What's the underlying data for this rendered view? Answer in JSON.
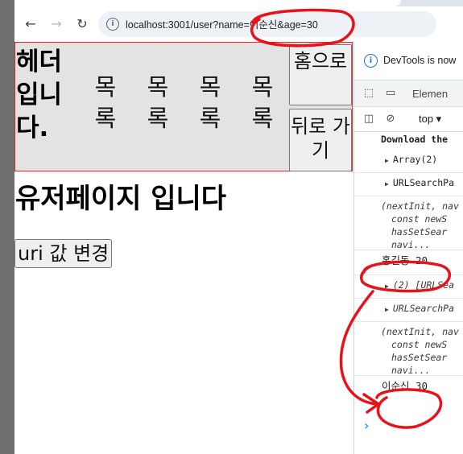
{
  "browser": {
    "back_icon": "back-arrow-icon",
    "forward_icon": "forward-arrow-icon",
    "reload_icon": "reload-icon",
    "url": "localhost:3001/user?name=이순신&age=30"
  },
  "page": {
    "header": {
      "title": "헤더 입니다.",
      "menu": [
        "목록",
        "목록",
        "목록",
        "목록"
      ],
      "home_button": "홈으로",
      "back_button": "뒤로 가기"
    },
    "title": "유저페이지 입니다",
    "change_button": "uri 값 변경"
  },
  "devtools": {
    "banner": "DevTools is now",
    "tab": "Elemen",
    "context": "top ▾",
    "console": {
      "download_hint": "Download the",
      "array_line": "Array(2)",
      "urlsearch_line": "URLSearchPa",
      "fn_line1": "(nextInit, nav",
      "fn_line2": "  const newS",
      "fn_line3": "  hasSetSear",
      "fn_line4": "  navi...",
      "log1": "홍길동 20",
      "array2_line": "(2) [URLSea",
      "urlsearch2_line": "URLSearchPa",
      "fn2_line1": "(nextInit, nav",
      "fn2_line2": "  const newS",
      "fn2_line3": "  hasSetSear",
      "fn2_line4": "  navi...",
      "log2": "이순신 30",
      "prompt": "›"
    }
  },
  "colors": {
    "annotation": "#e8121a",
    "header_border": "#e0262d",
    "link_blue": "#1a73e8"
  }
}
